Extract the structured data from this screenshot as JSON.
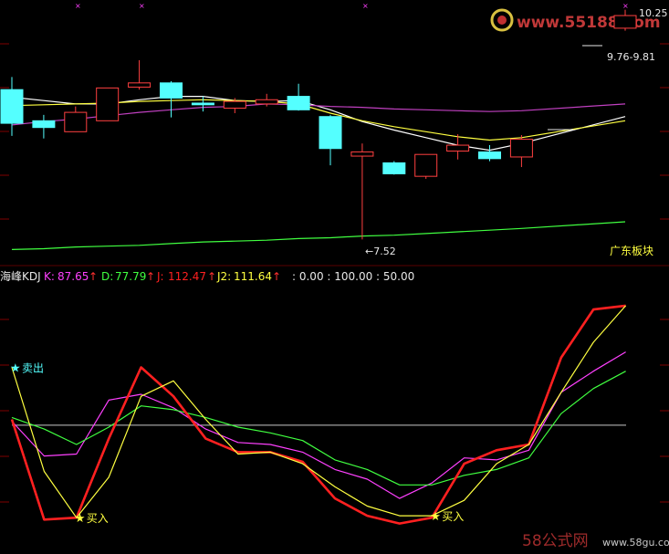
{
  "watermark_top": "www.55188.com",
  "watermark_bottom_left": "58公式网",
  "watermark_bottom_right": "www.58gu.com",
  "colors": {
    "background": "#000000",
    "bull": "#ff4040",
    "bear": "#54ffff",
    "k": "#ff40ff",
    "d": "#40ff40",
    "j": "#ff2020",
    "j2": "#ffff40",
    "ma_white": "#ffffff",
    "ma_yellow": "#ffff40",
    "ma_purple": "#c040c0",
    "ma_green": "#40ff40",
    "label_yellow": "#ffff40",
    "label_cyan": "#54ffff"
  },
  "chart_data": [
    {
      "type": "candlestick",
      "annotations": {
        "high_label": "10.25",
        "range_label": "9.76-9.81",
        "low_label": "←7.52",
        "sector_label": "广东板块"
      },
      "candles": [
        {
          "open": 9.3,
          "close": 8.9,
          "high": 9.45,
          "low": 8.75
        },
        {
          "open": 8.93,
          "close": 8.85,
          "high": 9.0,
          "low": 8.72
        },
        {
          "open": 8.8,
          "close": 9.03,
          "high": 9.1,
          "low": 8.8
        },
        {
          "open": 8.93,
          "close": 9.32,
          "high": 9.32,
          "low": 8.93
        },
        {
          "open": 9.33,
          "close": 9.38,
          "high": 9.65,
          "low": 9.3
        },
        {
          "open": 9.38,
          "close": 9.2,
          "high": 9.4,
          "low": 8.97
        },
        {
          "open": 9.14,
          "close": 9.12,
          "high": 9.22,
          "low": 9.04
        },
        {
          "open": 9.08,
          "close": 9.16,
          "high": 9.2,
          "low": 9.02
        },
        {
          "open": 9.13,
          "close": 9.18,
          "high": 9.25,
          "low": 9.1
        },
        {
          "open": 9.22,
          "close": 9.06,
          "high": 9.37,
          "low": 9.05
        },
        {
          "open": 8.98,
          "close": 8.6,
          "high": 9.0,
          "low": 8.4
        },
        {
          "open": 8.51,
          "close": 8.56,
          "high": 8.66,
          "low": 7.52
        },
        {
          "open": 8.43,
          "close": 8.3,
          "high": 8.45,
          "low": 8.29
        },
        {
          "open": 8.27,
          "close": 8.53,
          "high": 8.53,
          "low": 8.24
        },
        {
          "open": 8.57,
          "close": 8.64,
          "high": 8.77,
          "low": 8.47
        },
        {
          "open": 8.56,
          "close": 8.48,
          "high": 8.64,
          "low": 8.45
        },
        {
          "open": 8.5,
          "close": 8.71,
          "high": 8.76,
          "low": 8.38
        },
        {
          "open": 10.03,
          "close": 10.18,
          "high": 10.25,
          "low": 10.0
        }
      ],
      "ma_lines": [
        {
          "color_key": "ma_white",
          "values": [
            9.21,
            9.17,
            9.13,
            9.13,
            9.18,
            9.22,
            9.22,
            9.17,
            9.16,
            9.17,
            9.06,
            8.92,
            8.82,
            8.73,
            8.64,
            8.58,
            8.66,
            8.98
          ]
        },
        {
          "color_key": "ma_yellow",
          "values": [
            9.11,
            9.12,
            9.13,
            9.14,
            9.16,
            9.17,
            9.18,
            9.17,
            9.16,
            9.13,
            9.02,
            8.93,
            8.86,
            8.8,
            8.74,
            8.7,
            8.73,
            8.93
          ]
        },
        {
          "color_key": "ma_purple",
          "values": [
            8.88,
            8.92,
            8.95,
            8.99,
            9.03,
            9.06,
            9.09,
            9.1,
            9.13,
            9.12,
            9.1,
            9.09,
            9.07,
            9.06,
            9.05,
            9.04,
            9.05,
            9.13
          ]
        },
        {
          "color_key": "ma_green",
          "values": [
            7.4,
            7.41,
            7.43,
            7.44,
            7.45,
            7.47,
            7.49,
            7.5,
            7.51,
            7.53,
            7.54,
            7.56,
            7.57,
            7.59,
            7.61,
            7.63,
            7.65,
            7.73
          ]
        }
      ],
      "ylim": [
        7.35,
        10.3
      ]
    },
    {
      "type": "line",
      "title": "海峰KDJ",
      "params": ": 0.00 : 100.00 : 50.00",
      "legend": [
        {
          "name": "K:",
          "value": "87.65",
          "arrow": "↑",
          "color_key": "k"
        },
        {
          "name": "D:",
          "value": "77.79",
          "arrow": "↑",
          "color_key": "d"
        },
        {
          "name": "J:",
          "value": "112.47",
          "arrow": "↑",
          "color_key": "j"
        },
        {
          "name": "J2:",
          "value": "111.64",
          "arrow": "↑",
          "color_key": "j2"
        }
      ],
      "reference_line": 50,
      "ylim": [
        -5,
        120
      ],
      "series": [
        {
          "color_key": "k",
          "values": [
            52,
            34,
            35,
            63,
            66,
            59,
            48,
            41,
            40,
            36,
            27,
            22,
            12,
            20,
            33,
            32,
            37,
            67,
            78,
            88
          ]
        },
        {
          "color_key": "d",
          "values": [
            54,
            48,
            40,
            49,
            60,
            58,
            54,
            49,
            46,
            42,
            32,
            27,
            19,
            19,
            24,
            27,
            33,
            56,
            69,
            78
          ]
        },
        {
          "color_key": "j",
          "values": [
            53,
            1,
            2,
            43,
            80,
            65,
            43,
            36,
            36,
            31,
            12,
            3,
            -1,
            2,
            30,
            37,
            40,
            85,
            110,
            112
          ]
        },
        {
          "color_key": "j2",
          "values": [
            80,
            26,
            2,
            23,
            65,
            73,
            53,
            35,
            36,
            30,
            18,
            8,
            3,
            3,
            11,
            30,
            40,
            67,
            93,
            112
          ]
        }
      ],
      "signals": [
        {
          "label": "卖出",
          "index": 0,
          "value": 80,
          "color_key": "label_cyan"
        },
        {
          "label": "买入",
          "index": 2,
          "value": 2,
          "color_key": "label_yellow"
        },
        {
          "label": "买入",
          "index": 13,
          "value": 3,
          "color_key": "label_yellow"
        }
      ]
    }
  ]
}
